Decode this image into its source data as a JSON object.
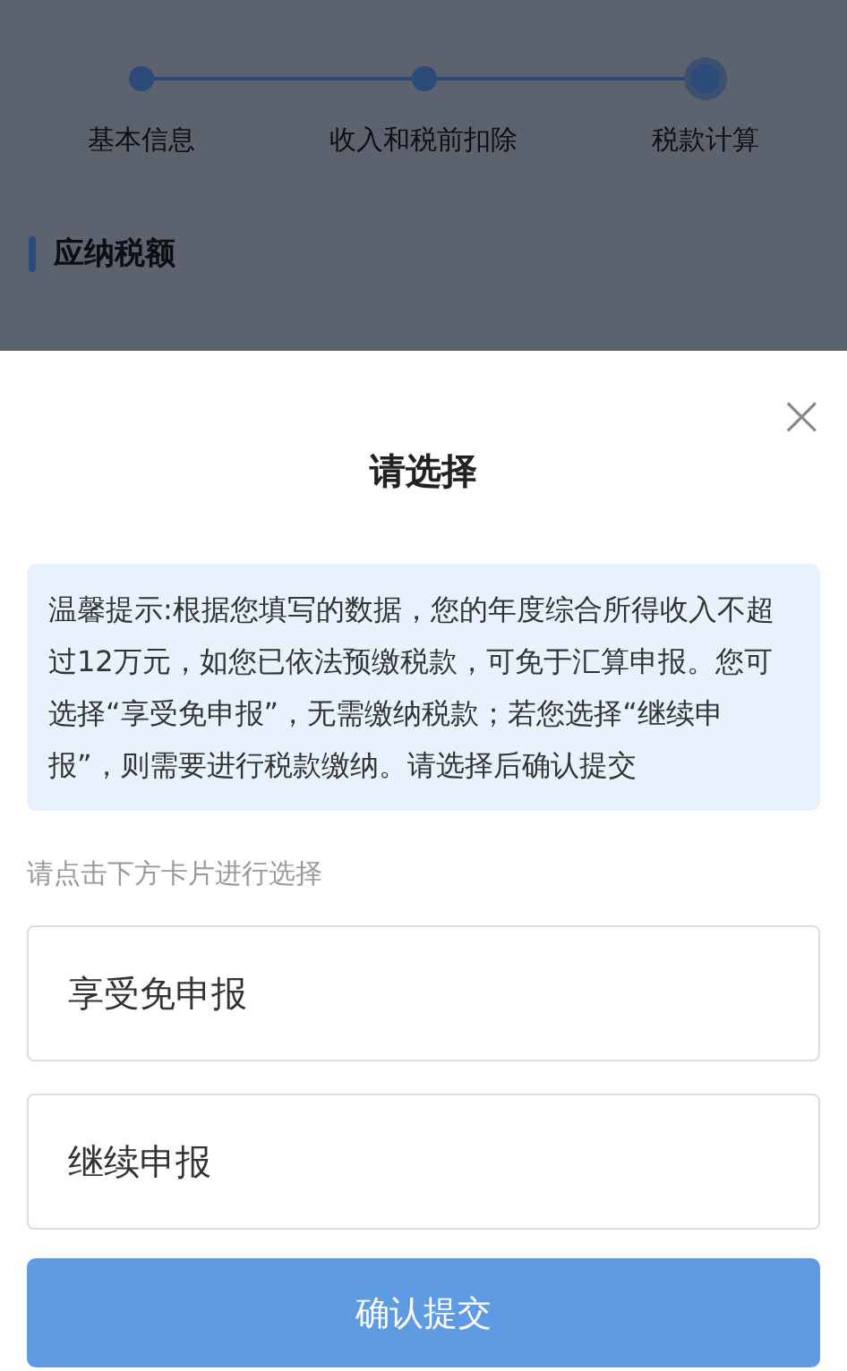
{
  "steps": [
    {
      "label": "基本信息",
      "current": false
    },
    {
      "label": "收入和税前扣除",
      "current": false
    },
    {
      "label": "税款计算",
      "current": true
    }
  ],
  "section_title": "应纳税额",
  "dialog": {
    "title": "请选择",
    "close": "×",
    "notice": "温馨提示:根据您填写的数据，您的年度综合所得收入不超过12万元，如您已依法预缴税款，可免于汇算申报。您可选择“享受免申报”，无需缴纳税款；若您选择“继续申报”，则需要进行税款缴纳。请选择后确认提交",
    "hint": "请点击下方卡片进行选择",
    "options": [
      {
        "label": "享受免申报",
        "selected": false
      },
      {
        "label": "继续申报",
        "selected": false
      }
    ],
    "confirm": {
      "label": "确认提交",
      "disabled": true
    }
  }
}
